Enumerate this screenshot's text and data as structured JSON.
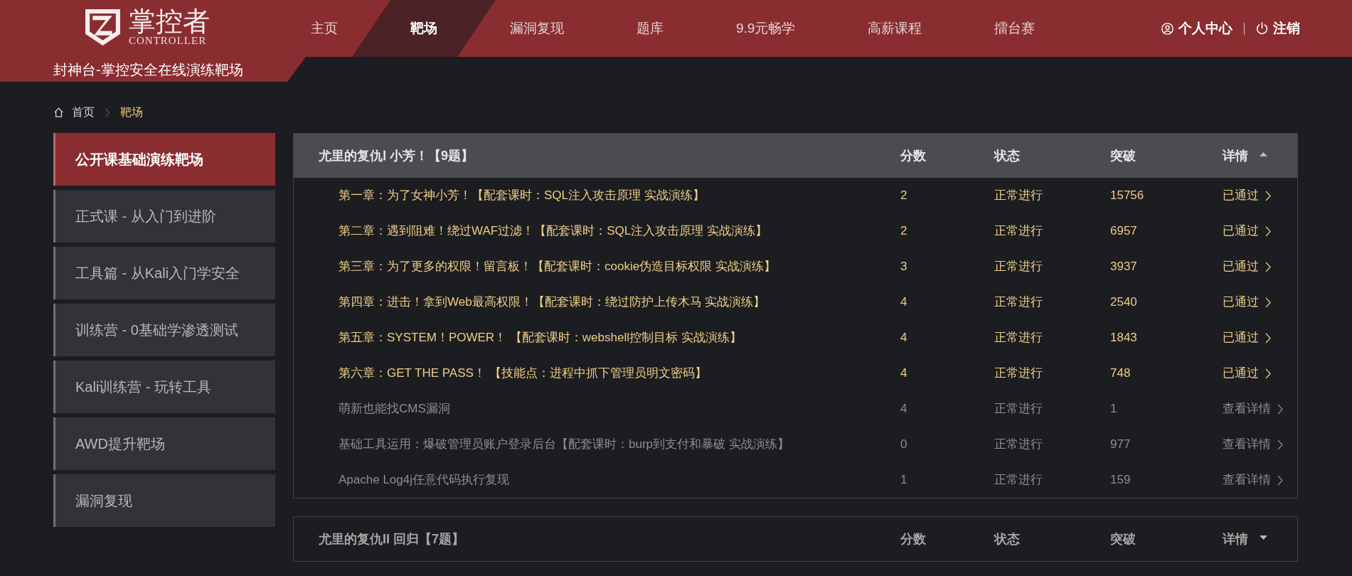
{
  "header": {
    "logo": {
      "name": "掌控者",
      "tagline": "CONTROLLER"
    },
    "subtitle": "封神台-掌控安全在线演练靶场",
    "nav": [
      {
        "label": "主页",
        "selected": false
      },
      {
        "label": "靶场",
        "selected": true
      },
      {
        "label": "漏洞复现",
        "selected": false
      },
      {
        "label": "题库",
        "selected": false
      },
      {
        "label": "9.9元畅学",
        "selected": false
      },
      {
        "label": "高薪课程",
        "selected": false
      },
      {
        "label": "擂台赛",
        "selected": false
      }
    ],
    "user_links": [
      {
        "label": "个人中心",
        "kind": "user"
      },
      {
        "label": "注销",
        "kind": "power"
      }
    ]
  },
  "breadcrumb": [
    {
      "label": "首页",
      "current": false
    },
    {
      "label": "靶场",
      "current": true
    }
  ],
  "sidebar": {
    "items": [
      {
        "label": "公开课基础演练靶场",
        "selected": true
      },
      {
        "label": "正式课 - 从入门到进阶",
        "selected": false
      },
      {
        "label": "工具篇 - 从Kali入门学安全",
        "selected": false
      },
      {
        "label": "训练营 - 0基础学渗透测试",
        "selected": false
      },
      {
        "label": "Kali训练营 - 玩转工具",
        "selected": false
      },
      {
        "label": "AWD提升靶场",
        "selected": false
      },
      {
        "label": "漏洞复现",
        "selected": false
      }
    ]
  },
  "sections": [
    {
      "title": "尤里的复仇Ⅰ 小芳！【9题】",
      "columns": [
        "分数",
        "状态",
        "突破",
        "详情"
      ],
      "expanded": true,
      "rows": [
        {
          "title": "第一章：为了女神小芳！【配套课时：SQL注入攻击原理 实战演练】",
          "score": "2",
          "status": "正常进行",
          "breaks": "15756",
          "detail": "已通过",
          "passed": true
        },
        {
          "title": "第二章：遇到阻难！绕过WAF过滤！【配套课时：SQL注入攻击原理 实战演练】",
          "score": "2",
          "status": "正常进行",
          "breaks": "6957",
          "detail": "已通过",
          "passed": true
        },
        {
          "title": "第三章：为了更多的权限！留言板！【配套课时：cookie伪造目标权限 实战演练】",
          "score": "3",
          "status": "正常进行",
          "breaks": "3937",
          "detail": "已通过",
          "passed": true
        },
        {
          "title": "第四章：进击！拿到Web最高权限！【配套课时：绕过防护上传木马 实战演练】",
          "score": "4",
          "status": "正常进行",
          "breaks": "2540",
          "detail": "已通过",
          "passed": true
        },
        {
          "title": "第五章：SYSTEM！POWER！ 【配套课时：webshell控制目标 实战演练】",
          "score": "4",
          "status": "正常进行",
          "breaks": "1843",
          "detail": "已通过",
          "passed": true
        },
        {
          "title": "第六章：GET THE PASS！ 【技能点：进程中抓下管理员明文密码】",
          "score": "4",
          "status": "正常进行",
          "breaks": "748",
          "detail": "已通过",
          "passed": true
        },
        {
          "title": "萌新也能找CMS漏洞",
          "score": "4",
          "status": "正常进行",
          "breaks": "1",
          "detail": "查看详情",
          "passed": false
        },
        {
          "title": "基础工具运用：爆破管理员账户登录后台【配套课时：burp到支付和暴破 实战演练】",
          "score": "0",
          "status": "正常进行",
          "breaks": "977",
          "detail": "查看详情",
          "passed": false
        },
        {
          "title": "Apache Log4j任意代码执行复现",
          "score": "1",
          "status": "正常进行",
          "breaks": "159",
          "detail": "查看详情",
          "passed": false
        }
      ]
    },
    {
      "title": "尤里的复仇II 回归【7题】",
      "columns": [
        "分数",
        "状态",
        "突破",
        "详情"
      ],
      "expanded": false
    }
  ]
}
